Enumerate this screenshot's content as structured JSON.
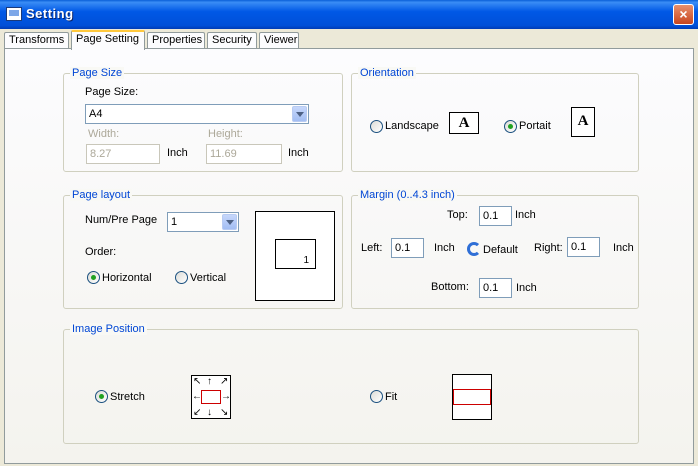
{
  "window": {
    "title": "Setting",
    "close_label": "×"
  },
  "tabs": [
    {
      "label": "Transforms"
    },
    {
      "label": "Page Setting",
      "active": true
    },
    {
      "label": "Properties"
    },
    {
      "label": "Security"
    },
    {
      "label": "Viewer"
    }
  ],
  "page_size": {
    "group_title": "Page Size",
    "size_label": "Page Size:",
    "size_value": "A4",
    "width_label": "Width:",
    "width_value": "8.27",
    "width_unit": "Inch",
    "height_label": "Height:",
    "height_value": "11.69",
    "height_unit": "Inch"
  },
  "orientation": {
    "group_title": "Orientation",
    "landscape_label": "Landscape",
    "portrait_label": "Portait",
    "page_glyph": "A",
    "selected": "portrait"
  },
  "page_layout": {
    "group_title": "Page layout",
    "num_label": "Num/Pre Page",
    "num_value": "1",
    "order_label": "Order:",
    "horizontal_label": "Horizontal",
    "vertical_label": "Vertical",
    "preview_number": "1",
    "selected": "horizontal"
  },
  "margin": {
    "group_title": "Margin (0..4.3 inch)",
    "top_label": "Top:",
    "top_value": "0.1",
    "top_unit": "Inch",
    "left_label": "Left:",
    "left_value": "0.1",
    "left_unit": "Inch",
    "default_label": "Default",
    "right_label": "Right:",
    "right_value": "0.1",
    "right_unit": "Inch",
    "bottom_label": "Bottom:",
    "bottom_value": "0.1",
    "bottom_unit": "Inch"
  },
  "image_position": {
    "group_title": "Image Position",
    "stretch_label": "Stretch",
    "fit_label": "Fit",
    "selected": "stretch"
  },
  "colors": {
    "group_title": "#0046d5",
    "accent_red": "#cc0000",
    "radio_check": "#21a121"
  }
}
